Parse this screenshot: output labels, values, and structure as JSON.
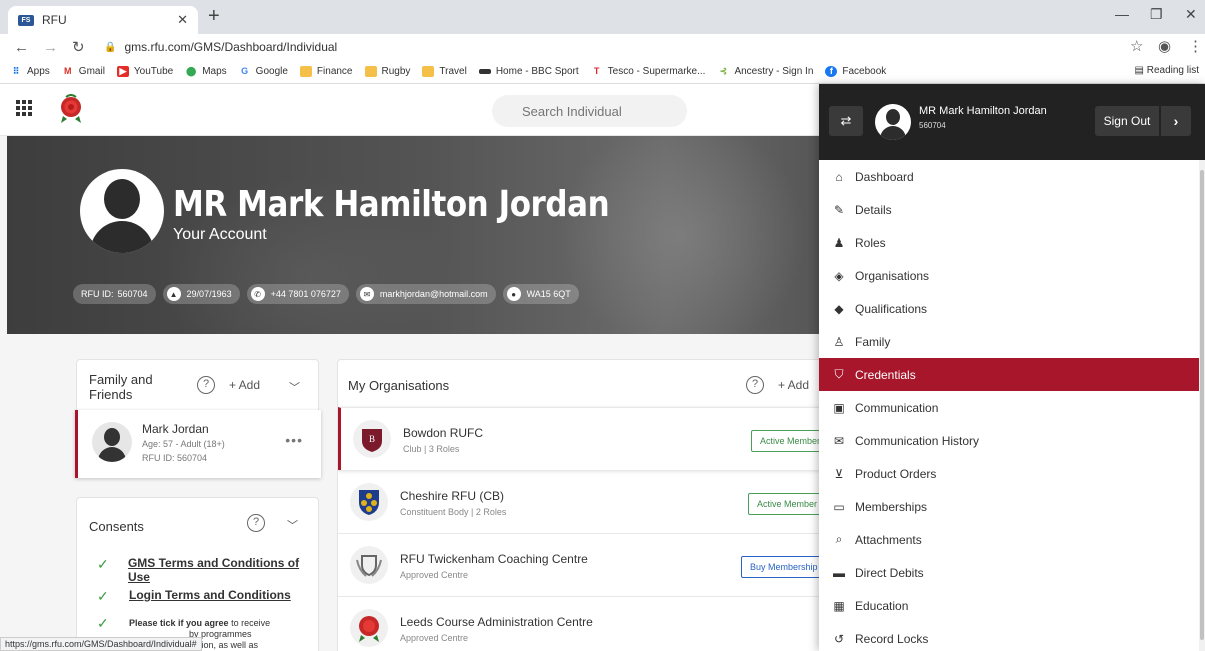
{
  "browser": {
    "tab_title": "RFU",
    "tab_favicon": "FS",
    "url": "gms.rfu.com/GMS/Dashboard/Individual",
    "bookmarks": [
      "Apps",
      "Gmail",
      "YouTube",
      "Maps",
      "Google",
      "Finance",
      "Rugby",
      "Travel",
      "Home - BBC Sport",
      "Tesco - Supermarke...",
      "Ancestry - Sign In",
      "Facebook"
    ],
    "reading_list": "Reading list",
    "status_url": "https://gms.rfu.com/GMS/Dashboard/Individual#"
  },
  "header": {
    "search_placeholder": "Search Individual"
  },
  "profile": {
    "name": "MR Mark Hamilton Jordan",
    "subtitle": "Your Account",
    "rfu_label": "RFU ID:",
    "rfu_id": "560704",
    "dob": "29/07/1963",
    "phone": "+44 7801 076727",
    "email": "markhjordan@hotmail.com",
    "postcode": "WA15 6QT"
  },
  "family": {
    "title_line1": "Family and",
    "title_line2": "Friends",
    "add_label": "+ Add",
    "member": {
      "name": "Mark Jordan",
      "age": "Age: 57 - Adult (18+)",
      "rfu": "RFU ID: 560704"
    }
  },
  "consents": {
    "title": "Consents",
    "items": [
      "GMS Terms and Conditions of Use",
      "Login Terms and Conditions"
    ],
    "partial_bold": "Please tick if you agree",
    "partial_rest": " to receive",
    "partial_line2": "by programmes",
    "partial_line3": "nation, as well as"
  },
  "organisations": {
    "title": "My Organisations",
    "add_label": "+ Add",
    "items": [
      {
        "name": "Bowdon RUFC",
        "type": "Club",
        "roles": "3 Roles",
        "badge": "Active Member"
      },
      {
        "name": "Cheshire RFU (CB)",
        "type": "Constituent Body",
        "roles": "2 Roles",
        "badge": "Active Member"
      },
      {
        "name": "RFU Twickenham Coaching Centre",
        "type": "Approved Centre",
        "roles": "",
        "badge": "Buy Membership"
      },
      {
        "name": "Leeds Course Administration Centre",
        "type": "Approved Centre",
        "roles": "",
        "badge": ""
      }
    ]
  },
  "menu": {
    "user_name": "MR Mark Hamilton Jordan",
    "user_id": "560704",
    "signout_label": "Sign Out",
    "items": [
      {
        "label": "Dashboard",
        "icon": "home-icon"
      },
      {
        "label": "Details",
        "icon": "user-edit-icon"
      },
      {
        "label": "Roles",
        "icon": "user-roles-icon"
      },
      {
        "label": "Organisations",
        "icon": "shield-icon"
      },
      {
        "label": "Qualifications",
        "icon": "graduation-cap-icon"
      },
      {
        "label": "Family",
        "icon": "family-icon"
      },
      {
        "label": "Credentials",
        "icon": "badge-shield-icon"
      },
      {
        "label": "Communication",
        "icon": "message-icon"
      },
      {
        "label": "Communication History",
        "icon": "envelope-icon"
      },
      {
        "label": "Product Orders",
        "icon": "cart-icon"
      },
      {
        "label": "Memberships",
        "icon": "monitor-icon"
      },
      {
        "label": "Attachments",
        "icon": "paperclip-icon"
      },
      {
        "label": "Direct Debits",
        "icon": "card-icon"
      },
      {
        "label": "Education",
        "icon": "calendar-icon"
      },
      {
        "label": "Record Locks",
        "icon": "lock-history-icon"
      }
    ],
    "active_item": "Credentials",
    "accent": "#a8162b"
  }
}
